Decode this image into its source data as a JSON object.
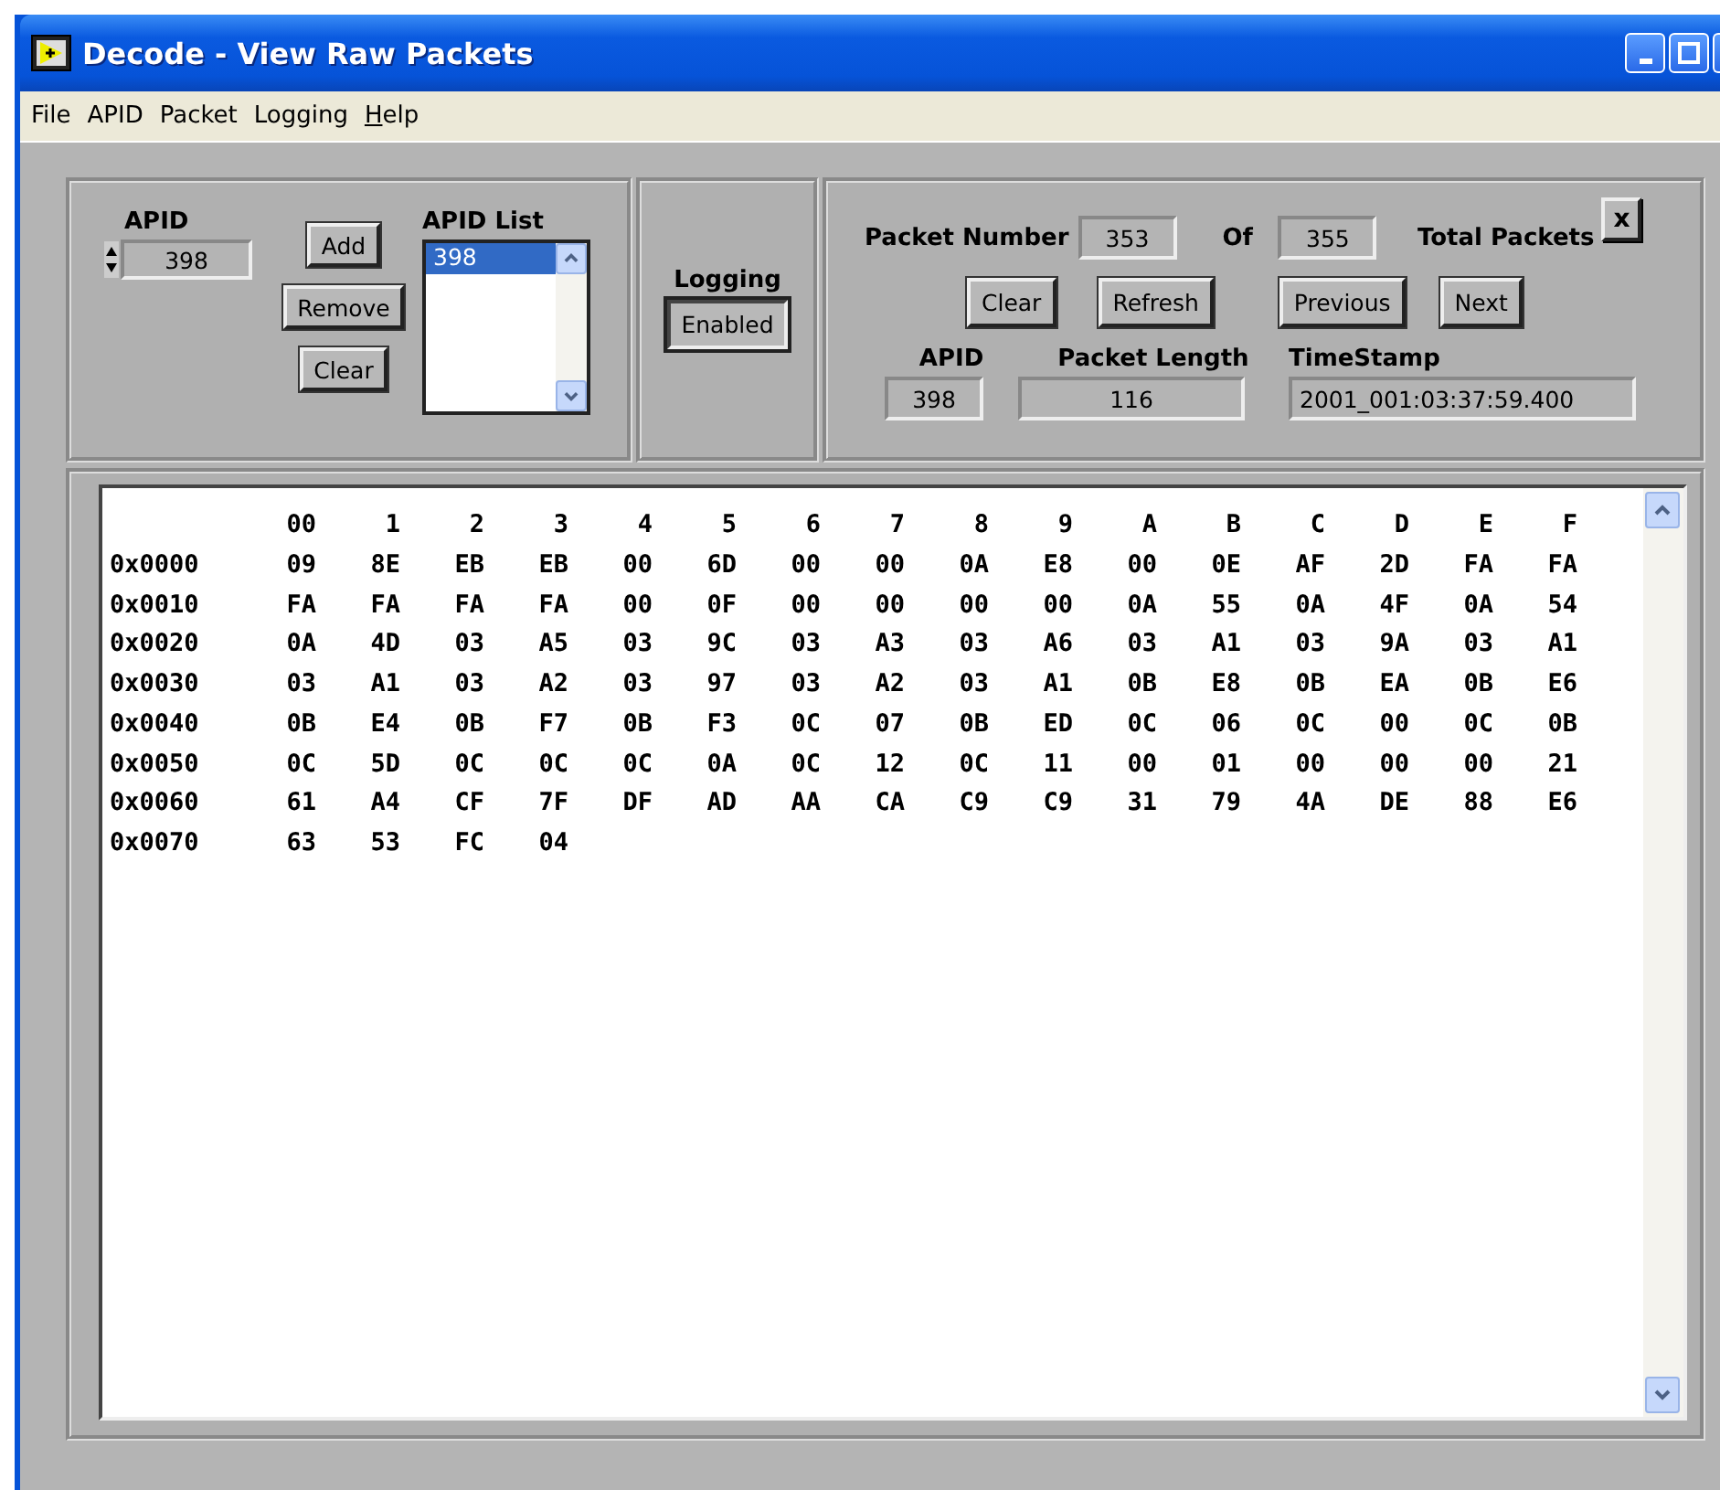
{
  "window": {
    "title": "Decode - View Raw Packets"
  },
  "menu": [
    {
      "label": "File",
      "accelerator": false
    },
    {
      "label": "APID",
      "accelerator": false
    },
    {
      "label": "Packet",
      "accelerator": false
    },
    {
      "label": "Logging",
      "accelerator": false
    },
    {
      "label": "Help",
      "accelerator": true
    }
  ],
  "apid_panel": {
    "apid_label": "APID",
    "apid_value": "398",
    "buttons": [
      "Add",
      "Remove",
      "Clear"
    ],
    "list_label": "APID List",
    "list_items": [
      {
        "label": "398",
        "selected": true
      }
    ]
  },
  "logging_panel": {
    "label": "Logging",
    "button": "Enabled"
  },
  "packet_panel": {
    "packet_number_label": "Packet Number",
    "packet_number": "353",
    "of_label": "Of",
    "total": "355",
    "total_label": "Total Packets",
    "close_button": "x",
    "buttons": [
      "Clear",
      "Refresh",
      "Previous",
      "Next"
    ],
    "fields": [
      {
        "label": "APID",
        "value": "398"
      },
      {
        "label": "Packet Length",
        "value": "116"
      },
      {
        "label": "TimeStamp",
        "value": "2001_001:03:37:59.400"
      }
    ]
  },
  "hex_view": {
    "columns": [
      "00",
      "1",
      "2",
      "3",
      "4",
      "5",
      "6",
      "7",
      "8",
      "9",
      "A",
      "B",
      "C",
      "D",
      "E",
      "F"
    ],
    "rows": [
      {
        "address": "0x0000",
        "bytes": [
          "09",
          "8E",
          "EB",
          "EB",
          "00",
          "6D",
          "00",
          "00",
          "0A",
          "E8",
          "00",
          "0E",
          "AF",
          "2D",
          "FA",
          "FA"
        ]
      },
      {
        "address": "0x0010",
        "bytes": [
          "FA",
          "FA",
          "FA",
          "FA",
          "00",
          "0F",
          "00",
          "00",
          "00",
          "00",
          "0A",
          "55",
          "0A",
          "4F",
          "0A",
          "54"
        ]
      },
      {
        "address": "0x0020",
        "bytes": [
          "0A",
          "4D",
          "03",
          "A5",
          "03",
          "9C",
          "03",
          "A3",
          "03",
          "A6",
          "03",
          "A1",
          "03",
          "9A",
          "03",
          "A1"
        ]
      },
      {
        "address": "0x0030",
        "bytes": [
          "03",
          "A1",
          "03",
          "A2",
          "03",
          "97",
          "03",
          "A2",
          "03",
          "A1",
          "0B",
          "E8",
          "0B",
          "EA",
          "0B",
          "E6"
        ]
      },
      {
        "address": "0x0040",
        "bytes": [
          "0B",
          "E4",
          "0B",
          "F7",
          "0B",
          "F3",
          "0C",
          "07",
          "0B",
          "ED",
          "0C",
          "06",
          "0C",
          "00",
          "0C",
          "0B"
        ]
      },
      {
        "address": "0x0050",
        "bytes": [
          "0C",
          "5D",
          "0C",
          "0C",
          "0C",
          "0A",
          "0C",
          "12",
          "0C",
          "11",
          "00",
          "01",
          "00",
          "00",
          "00",
          "21"
        ]
      },
      {
        "address": "0x0060",
        "bytes": [
          "61",
          "A4",
          "CF",
          "7F",
          "DF",
          "AD",
          "AA",
          "CA",
          "C9",
          "C9",
          "31",
          "79",
          "4A",
          "DE",
          "88",
          "E6"
        ]
      },
      {
        "address": "0x0070",
        "bytes": [
          "63",
          "53",
          "FC",
          "04"
        ]
      }
    ]
  }
}
